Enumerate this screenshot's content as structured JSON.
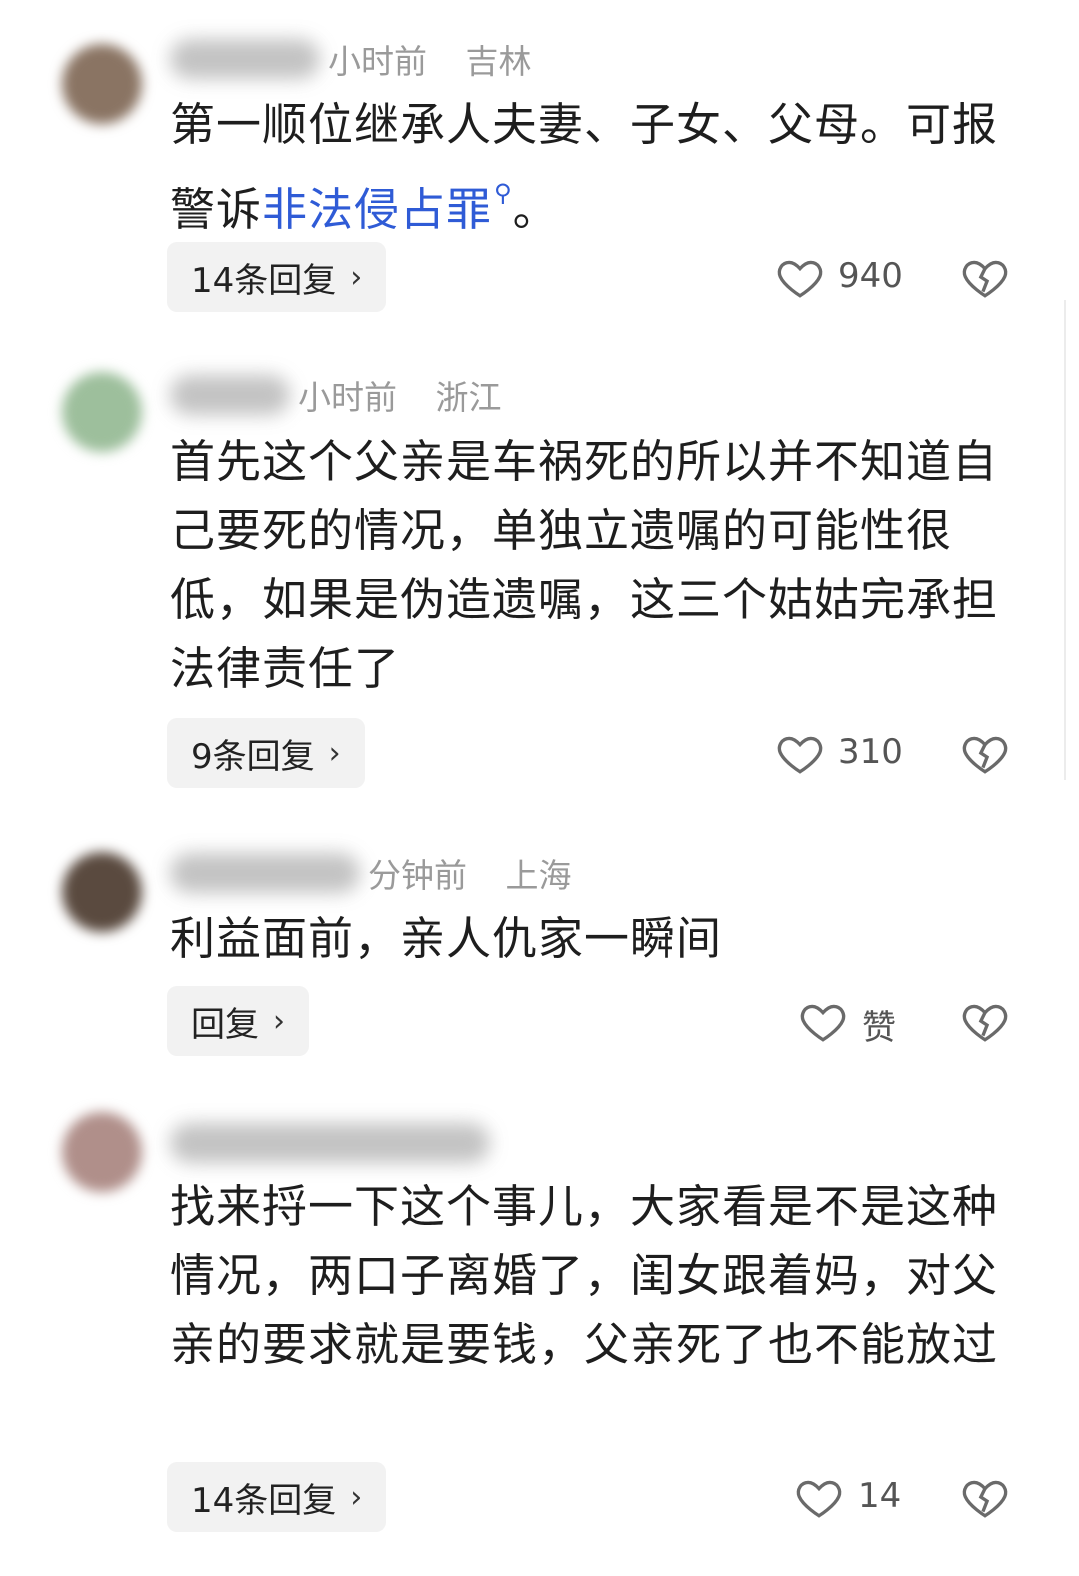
{
  "comments": [
    {
      "time": "小时前",
      "location": "吉林",
      "text_plain": "第一顺位继承人夫妻、子女、父母。可报警诉",
      "link_text": "非法侵占罪",
      "link_icon": "search-icon",
      "text_after": "。",
      "reply_label": "14条回复",
      "like_label": "940"
    },
    {
      "time": "小时前",
      "location": "浙江",
      "text": "首先这个父亲是车祸死的所以并不知道自己要死的情况，单独立遗嘱的可能性很低，如果是伪造遗嘱，这三个姑姑完承担法律责任了",
      "reply_label": "9条回复",
      "like_label": "310"
    },
    {
      "time": "分钟前",
      "location": "上海",
      "text": "利益面前，亲人仇家一瞬间",
      "reply_label": "回复",
      "like_label": "赞"
    },
    {
      "time": "",
      "location": "",
      "text": "找来捋一下这个事儿，大家看是不是这种情况，两口子离婚了，闺女跟着妈，对父亲的要求就是要钱，父亲死了也不能放过",
      "reply_label": "14条回复",
      "like_label": "14"
    }
  ],
  "icons": {
    "like": "heart-outline-icon",
    "dislike": "broken-heart-icon",
    "chevron": "chevron-right-icon"
  },
  "colors": {
    "link": "#2f5bd6",
    "meta": "#9a9a9a",
    "reply_bg": "#f2f2f2"
  }
}
